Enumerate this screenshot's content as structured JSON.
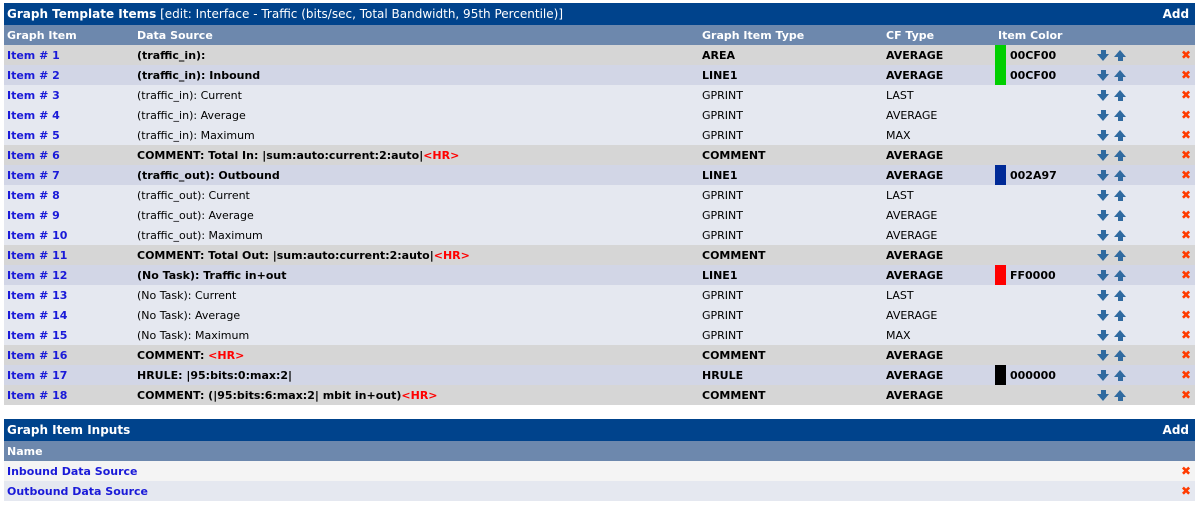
{
  "items_table": {
    "title": "Graph Template Items",
    "subtitle": "[edit: Interface - Traffic (bits/sec, Total Bandwidth, 95th Percentile)]",
    "add_label": "Add",
    "columns": [
      "Graph Item",
      "Data Source",
      "Graph Item Type",
      "CF Type",
      "Item Color"
    ],
    "rows": [
      {
        "item": "Item # 1",
        "source": "(traffic_in):",
        "hr": "",
        "type": "AREA",
        "cf": "AVERAGE",
        "color": "00CF00",
        "style": "grey"
      },
      {
        "item": "Item # 2",
        "source": "(traffic_in): Inbound",
        "hr": "",
        "type": "LINE1",
        "cf": "AVERAGE",
        "color": "00CF00",
        "style": "blue"
      },
      {
        "item": "Item # 3",
        "source": "(traffic_in): Current",
        "hr": "",
        "type": "GPRINT",
        "cf": "LAST",
        "color": "",
        "style": "light"
      },
      {
        "item": "Item # 4",
        "source": "(traffic_in): Average",
        "hr": "",
        "type": "GPRINT",
        "cf": "AVERAGE",
        "color": "",
        "style": "light"
      },
      {
        "item": "Item # 5",
        "source": "(traffic_in): Maximum",
        "hr": "",
        "type": "GPRINT",
        "cf": "MAX",
        "color": "",
        "style": "light"
      },
      {
        "item": "Item # 6",
        "source": "COMMENT: Total In: |sum:auto:current:2:auto|",
        "hr": "<HR>",
        "type": "COMMENT",
        "cf": "AVERAGE",
        "color": "",
        "style": "grey"
      },
      {
        "item": "Item # 7",
        "source": "(traffic_out): Outbound",
        "hr": "",
        "type": "LINE1",
        "cf": "AVERAGE",
        "color": "002A97",
        "style": "blue"
      },
      {
        "item": "Item # 8",
        "source": "(traffic_out): Current",
        "hr": "",
        "type": "GPRINT",
        "cf": "LAST",
        "color": "",
        "style": "light"
      },
      {
        "item": "Item # 9",
        "source": "(traffic_out): Average",
        "hr": "",
        "type": "GPRINT",
        "cf": "AVERAGE",
        "color": "",
        "style": "light"
      },
      {
        "item": "Item # 10",
        "source": "(traffic_out): Maximum",
        "hr": "",
        "type": "GPRINT",
        "cf": "AVERAGE",
        "color": "",
        "style": "light"
      },
      {
        "item": "Item # 11",
        "source": "COMMENT: Total Out: |sum:auto:current:2:auto|",
        "hr": "<HR>",
        "type": "COMMENT",
        "cf": "AVERAGE",
        "color": "",
        "style": "grey"
      },
      {
        "item": "Item # 12",
        "source": "(No Task): Traffic in+out",
        "hr": "",
        "type": "LINE1",
        "cf": "AVERAGE",
        "color": "FF0000",
        "style": "blue"
      },
      {
        "item": "Item # 13",
        "source": "(No Task): Current",
        "hr": "",
        "type": "GPRINT",
        "cf": "LAST",
        "color": "",
        "style": "light"
      },
      {
        "item": "Item # 14",
        "source": "(No Task): Average",
        "hr": "",
        "type": "GPRINT",
        "cf": "AVERAGE",
        "color": "",
        "style": "light"
      },
      {
        "item": "Item # 15",
        "source": "(No Task): Maximum",
        "hr": "",
        "type": "GPRINT",
        "cf": "MAX",
        "color": "",
        "style": "light"
      },
      {
        "item": "Item # 16",
        "source": "COMMENT: ",
        "hr": "<HR>",
        "type": "COMMENT",
        "cf": "AVERAGE",
        "color": "",
        "style": "grey"
      },
      {
        "item": "Item # 17",
        "source": "HRULE: |95:bits:0:max:2|",
        "hr": "",
        "type": "HRULE",
        "cf": "AVERAGE",
        "color": "000000",
        "style": "blue"
      },
      {
        "item": "Item # 18",
        "source": "COMMENT: (|95:bits:6:max:2| mbit in+out)",
        "hr": "<HR>",
        "type": "COMMENT",
        "cf": "AVERAGE",
        "color": "",
        "style": "grey"
      }
    ]
  },
  "inputs_table": {
    "title": "Graph Item Inputs",
    "add_label": "Add",
    "columns": [
      "Name"
    ],
    "rows": [
      {
        "name": "Inbound Data Source"
      },
      {
        "name": "Outbound Data Source"
      }
    ]
  },
  "icons": {
    "move_down": "arrow-down-icon",
    "move_up": "arrow-up-icon",
    "delete": "delete-x-icon",
    "delete_glyph": "✖"
  },
  "colors": {
    "title_bg": "#00438c",
    "header_bg": "#6d88ad",
    "link": "#1a1ad8",
    "hr_tag": "#ff0000",
    "arrow": "#2f6aa0",
    "delete": "#ff3b00"
  }
}
